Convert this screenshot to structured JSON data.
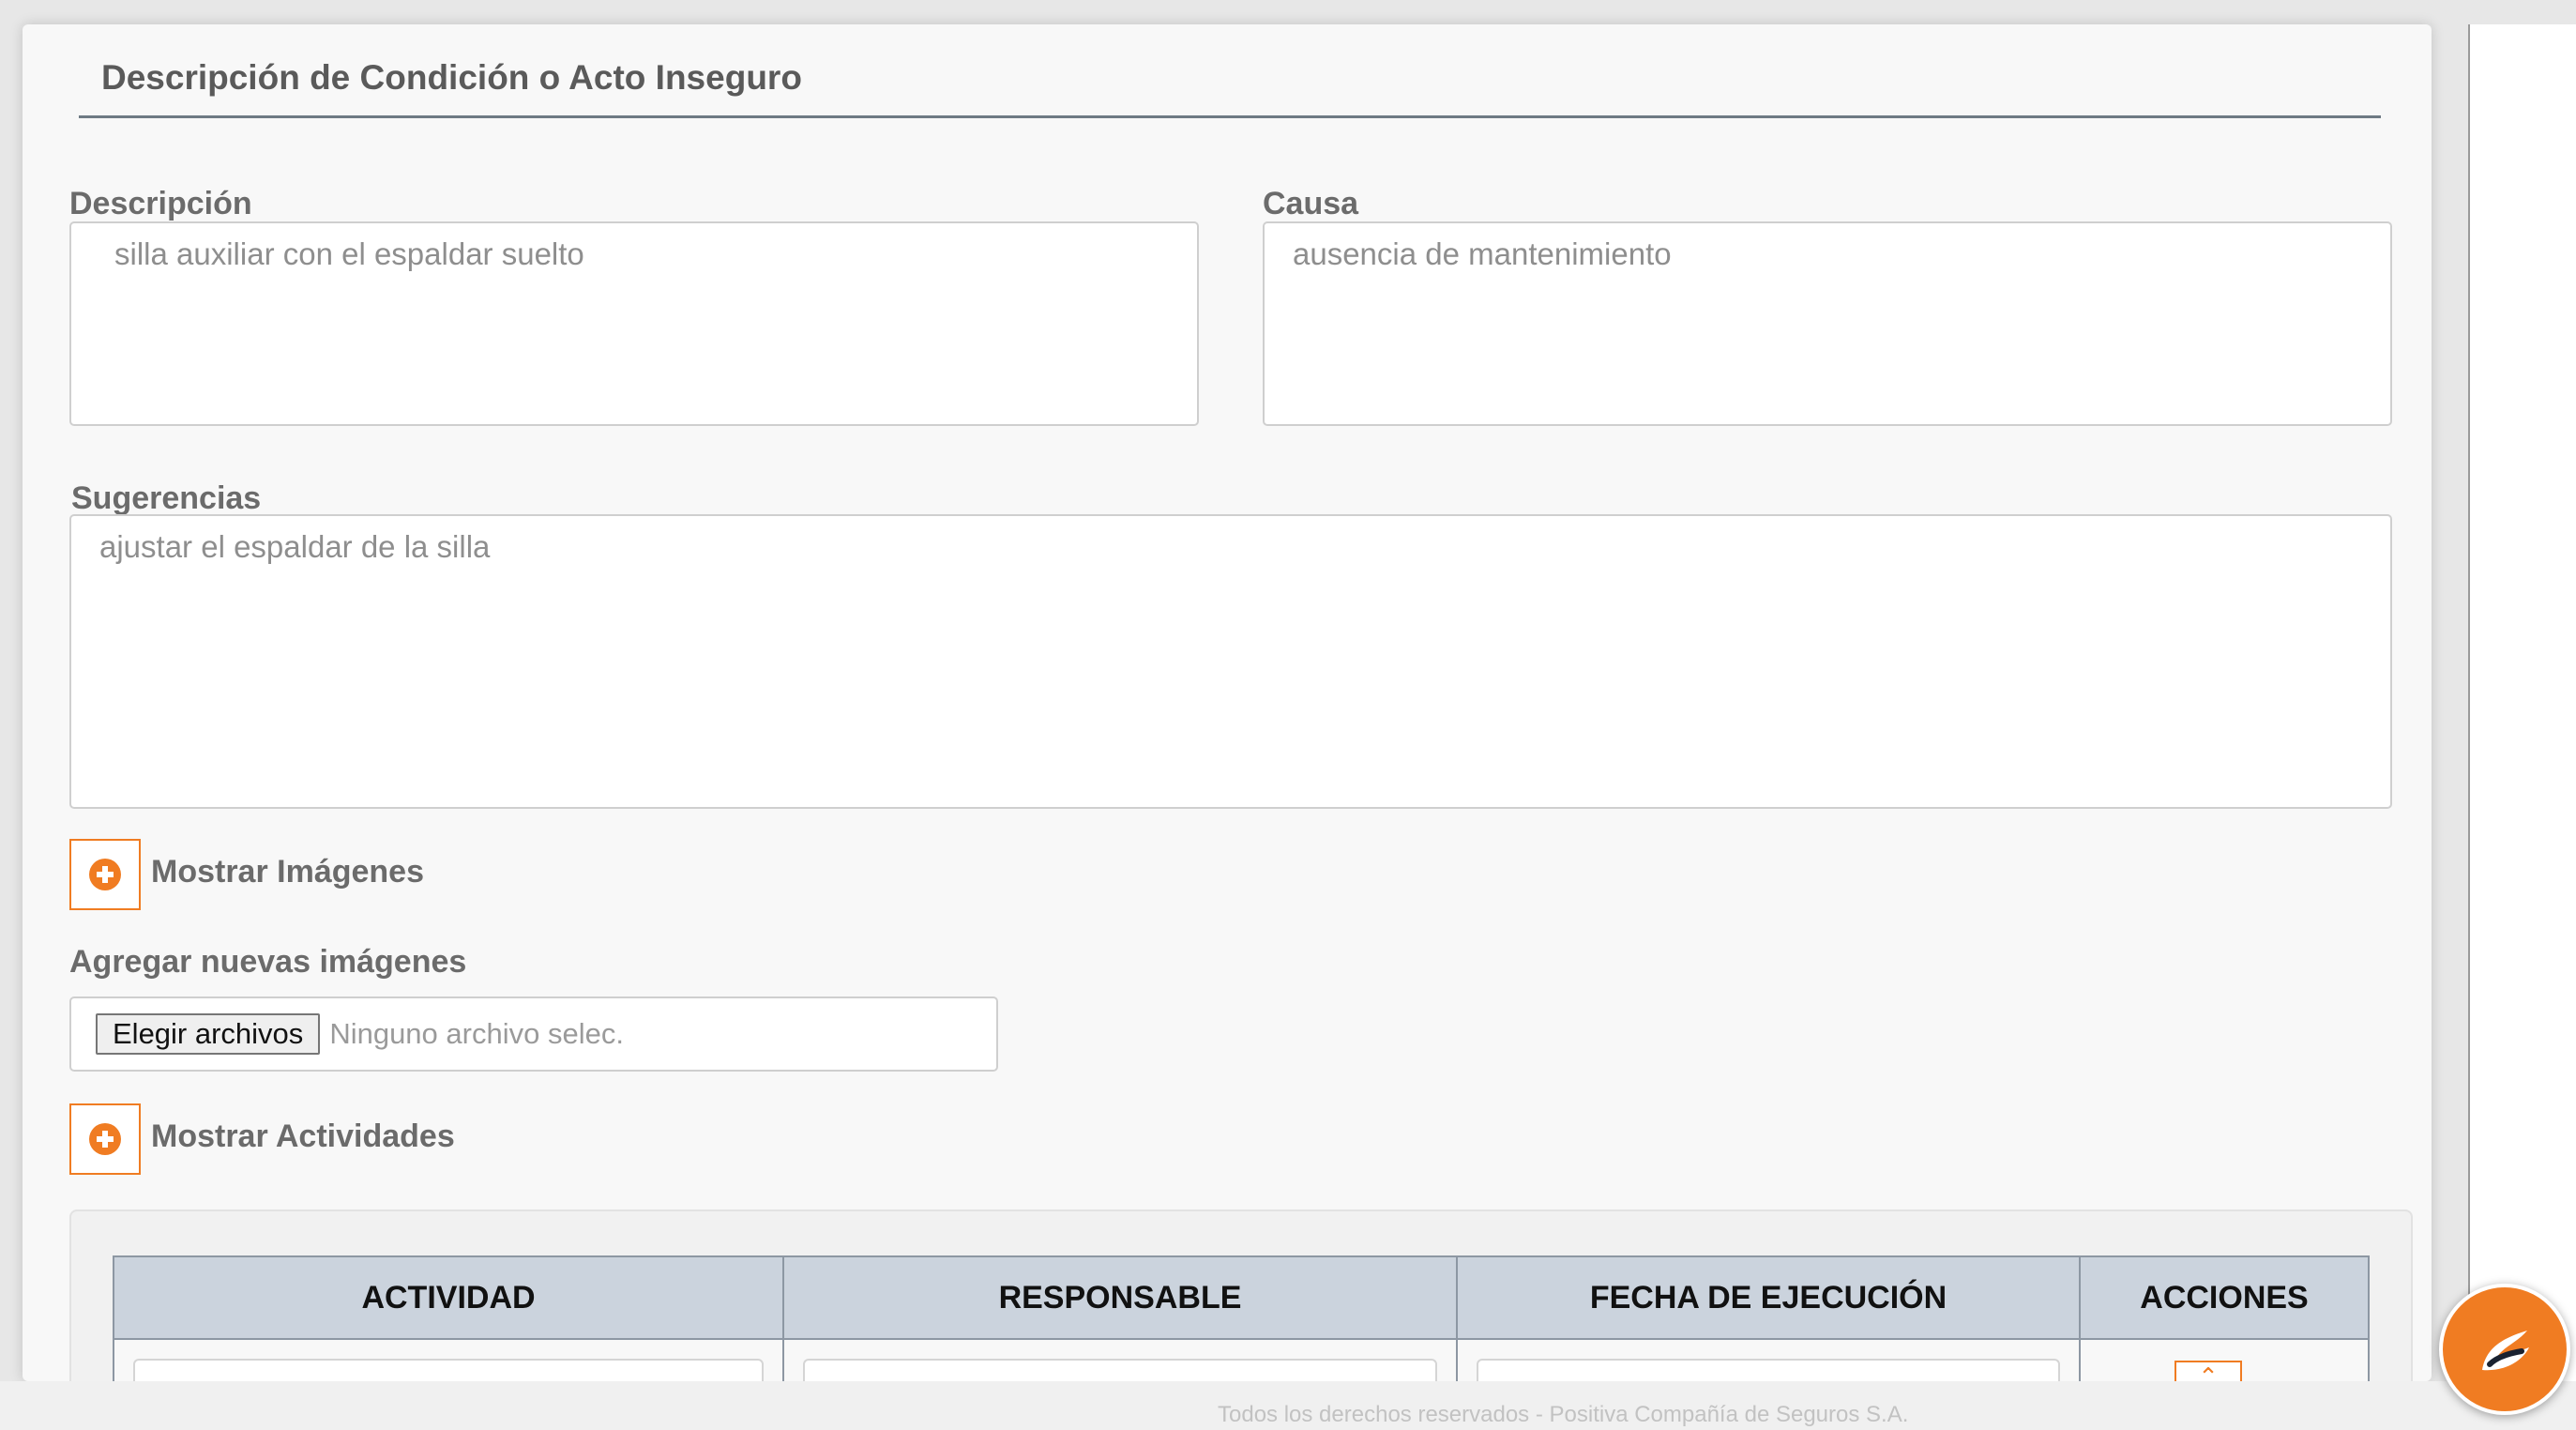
{
  "section": {
    "title": "Descripción de Condición o Acto Inseguro"
  },
  "fields": {
    "descripcion": {
      "label": "Descripción",
      "value": "silla auxiliar con el espaldar suelto"
    },
    "causa": {
      "label": "Causa",
      "value": "ausencia de mantenimiento"
    },
    "sugerencias": {
      "label": "Sugerencias",
      "value": "ajustar el espaldar de la silla"
    }
  },
  "images": {
    "toggle_label": "Mostrar Imágenes",
    "add_label": "Agregar nuevas imágenes",
    "file_button": "Elegir archivos",
    "file_status": "Ninguno archivo selec."
  },
  "activities": {
    "toggle_label": "Mostrar Actividades",
    "columns": [
      "ACTIVIDAD",
      "RESPONSABLE",
      "FECHA DE EJECUCIÓN",
      "ACCIONES"
    ]
  },
  "footer": {
    "text": "Todos los derechos reservados - Positiva Compañía de Seguros S.A."
  },
  "colors": {
    "accent": "#f07c22",
    "header_bg": "#cbd3dd"
  },
  "icons": {
    "toggle": "plus-circle-icon",
    "chat": "chat-bot-icon",
    "action": "chevron-up-icon"
  }
}
